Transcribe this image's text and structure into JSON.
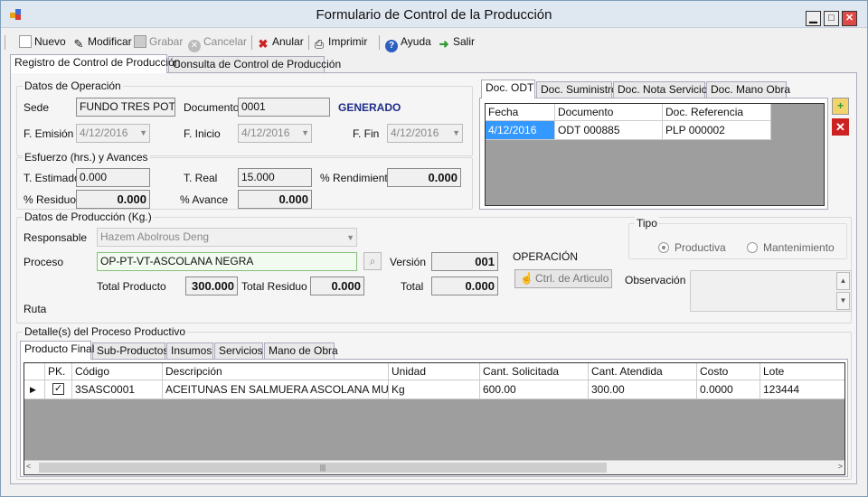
{
  "window": {
    "title": "Formulario de Control de la Producción"
  },
  "toolbar": {
    "nuevo": "Nuevo",
    "modificar": "Modificar",
    "grabar": "Grabar",
    "cancelar": "Cancelar",
    "anular": "Anular",
    "imprimir": "Imprimir",
    "ayuda": "Ayuda",
    "salir": "Salir"
  },
  "main_tabs": {
    "registro": "Registro de Control de Producción",
    "consulta": "Consulta de Control de Producción"
  },
  "operacion": {
    "group_title": "Datos de Operación",
    "sede_label": "Sede",
    "sede_value": "FUNDO TRES POTRILLOS",
    "documento_label": "Documento",
    "documento_value": "0001",
    "status": "GENERADO",
    "emision_label": "F. Emisión",
    "emision_value": "4/12/2016",
    "inicio_label": "F. Inicio",
    "inicio_value": "4/12/2016",
    "fin_label": "F. Fin",
    "fin_value": "4/12/2016"
  },
  "esfuerzo": {
    "group_title": "Esfuerzo (hrs.) y Avances",
    "estimado_label": "T. Estimado",
    "estimado_value": "0.000",
    "real_label": "T. Real",
    "real_value": "15.000",
    "rendimiento_label": "% Rendimiento",
    "rendimiento_value": "0.000",
    "residuo_label": "% Residuo",
    "residuo_value": "0.000",
    "avance_label": "% Avance",
    "avance_value": "0.000"
  },
  "doc_tabs": [
    "Doc. ODT",
    "Doc. Suministro",
    "Doc. Nota Servicio",
    "Doc. Mano Obra"
  ],
  "odt_grid": {
    "headers": [
      "Fecha",
      "Documento",
      "Doc. Referencia"
    ],
    "rows": [
      [
        "4/12/2016",
        "ODT 000885",
        "PLP 000002"
      ]
    ]
  },
  "produccion": {
    "group_title": "Datos de Producción (Kg.)",
    "responsable_label": "Responsable",
    "responsable_value": "Hazem Abolrous Deng",
    "proceso_label": "Proceso",
    "proceso_value": "OP-PT-VT-ASCOLANA NEGRA",
    "version_label": "Versión",
    "version_value": "001",
    "operacion_label": "OPERACIÓN",
    "total_producto_label": "Total Producto",
    "total_producto_value": "300.000",
    "total_residuo_label": "Total Residuo",
    "total_residuo_value": "0.000",
    "total_label": "Total",
    "total_value": "0.000",
    "ctrl_button": "Ctrl. de Articulo",
    "ruta_label": "Ruta",
    "tipo_title": "Tipo",
    "tipo_productiva": "Productiva",
    "tipo_mantenimiento": "Mantenimiento",
    "observacion_label": "Observación"
  },
  "detalle": {
    "group_title": "Detalle(s) del Proceso Productivo",
    "tabs": [
      "Producto Final",
      "Sub-Productos",
      "Insumos",
      "Servicios",
      "Mano de Obra"
    ],
    "headers": [
      "PK.",
      "Código",
      "Descripción",
      "Unidad",
      "Cant. Solicitada",
      "Cant. Atendida",
      "Costo",
      "Lote"
    ],
    "rows": [
      [
        "3SASC0001",
        "ACEITUNAS EN SALMUERA ASCOLANA MUL...",
        "Kg",
        "600.00",
        "300.00",
        "0.0000",
        "123444"
      ]
    ]
  },
  "colors": {
    "accent": "#1f2d8a",
    "selection": "#3399ff",
    "grid_bg": "#9e9e9e",
    "delete_red": "#cc2222"
  },
  "icons": [
    "app-icon",
    "new-doc-icon",
    "edit-icon",
    "save-icon",
    "cancel-icon",
    "delete-icon",
    "print-icon",
    "help-icon",
    "exit-icon",
    "search-icon",
    "add-folder-icon",
    "remove-icon"
  ]
}
